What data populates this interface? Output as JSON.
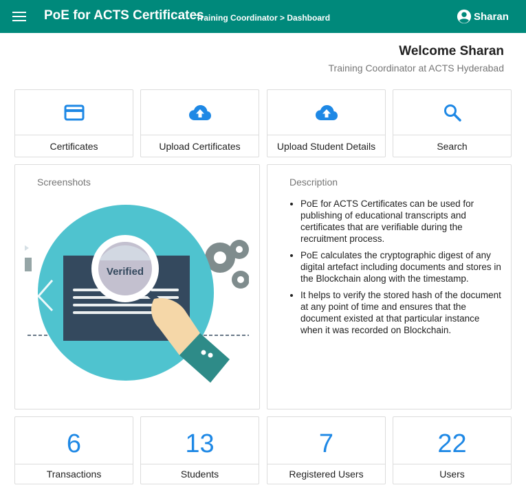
{
  "header": {
    "app_title": "PoE for ACTS Certificates",
    "breadcrumb": "Training Coordinator > Dashboard",
    "user_name": "Sharan"
  },
  "welcome": {
    "title": "Welcome Sharan",
    "subtitle": "Training Coordinator at ACTS Hyderabad"
  },
  "actions": [
    {
      "label": "Certificates",
      "icon": "credit-card-icon"
    },
    {
      "label": "Upload Certificates",
      "icon": "cloud-upload-icon"
    },
    {
      "label": "Upload Student Details",
      "icon": "cloud-upload-icon"
    },
    {
      "label": "Search",
      "icon": "search-icon"
    }
  ],
  "screenshots": {
    "title": "Screenshots",
    "stamp_text": "Verified"
  },
  "description": {
    "title": "Description",
    "items": [
      "PoE for ACTS Certificates can be used for publishing of educational transcripts and certificates that are verifiable during the recruitment process.",
      "PoE calculates the cryptographic digest of any digital artefact including documents and stores in the Blockchain along with the timestamp.",
      "It helps to verify the stored hash of the document at any point of time and ensures that the document existed at that particular instance when it was recorded on Blockchain."
    ]
  },
  "stats": [
    {
      "value": "6",
      "label": "Transactions"
    },
    {
      "value": "13",
      "label": "Students"
    },
    {
      "value": "7",
      "label": "Registered Users"
    },
    {
      "value": "22",
      "label": "Users"
    }
  ],
  "colors": {
    "header_bg": "#00897b",
    "accent": "#1e88e5",
    "illustration_circle": "#4fc3cf",
    "document": "#34495e"
  }
}
